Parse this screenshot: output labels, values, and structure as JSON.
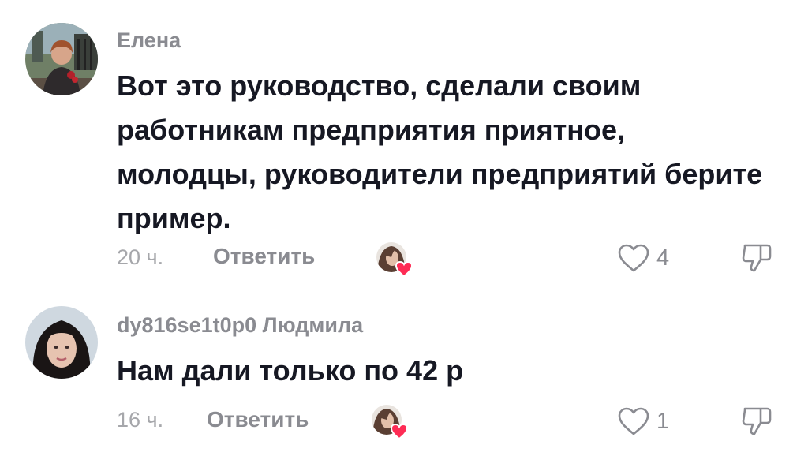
{
  "comments": [
    {
      "username": "Елена",
      "text": "Вот это руководство, сделали своим работникам предприятия приятное, молодцы, руководители предприятий берите пример.",
      "time": "20 ч.",
      "reply_label": "Ответить",
      "likes": "4",
      "liked_by_creator": true
    },
    {
      "username": "dy816se1t0p0 Людмила",
      "text": "Нам дали только по 42 р",
      "time": "16 ч.",
      "reply_label": "Ответить",
      "likes": "1",
      "liked_by_creator": true
    }
  ],
  "icons": {
    "like": "heart-outline-icon",
    "dislike": "thumbs-down-icon",
    "creator_like": "creator-avatar-heart-icon"
  },
  "colors": {
    "primary_text": "#161823",
    "secondary_text": "#8a8b91",
    "heart_badge": "#fe2c55"
  }
}
